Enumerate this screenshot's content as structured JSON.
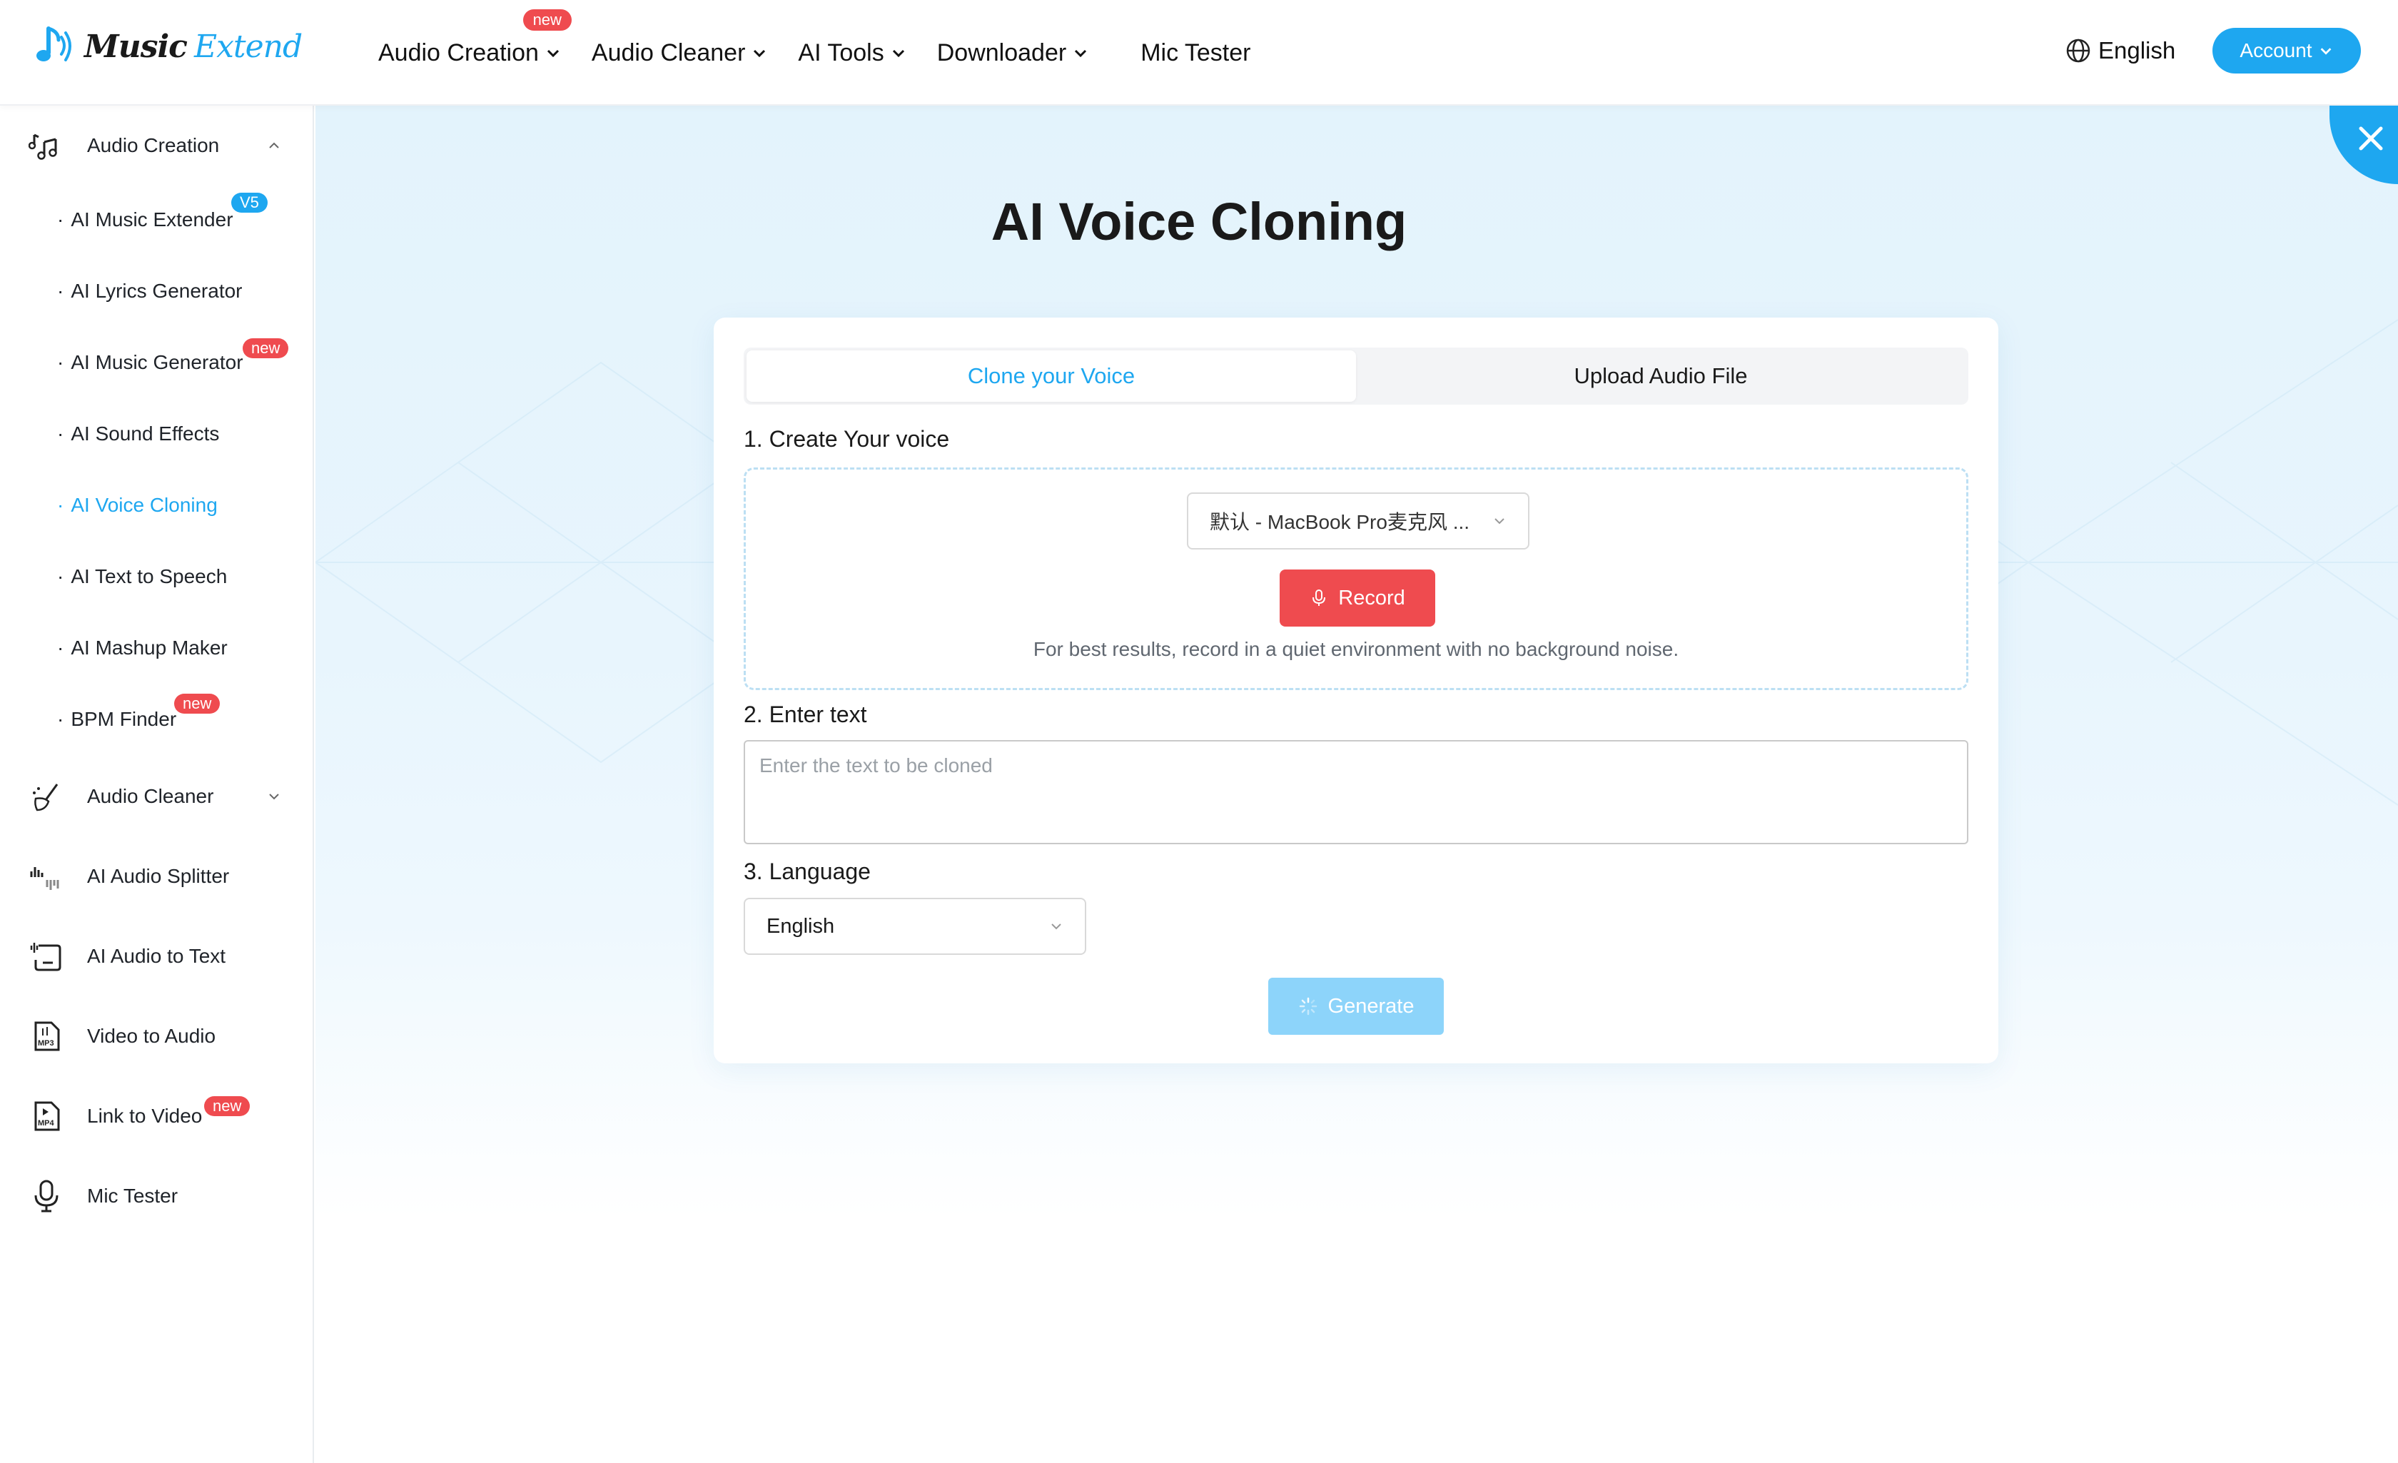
{
  "header": {
    "logo": {
      "word1": "Music",
      "word2": "Extend"
    },
    "nav": [
      {
        "label": "Audio Creation",
        "badge": "new",
        "dropdown": true
      },
      {
        "label": "Audio Cleaner",
        "dropdown": true
      },
      {
        "label": "AI Tools",
        "dropdown": true
      },
      {
        "label": "Downloader",
        "dropdown": true
      },
      {
        "label": "Mic Tester",
        "dropdown": false
      }
    ],
    "language": "English",
    "account_label": "Account"
  },
  "sidebar": {
    "groups": [
      {
        "label": "Audio Creation",
        "icon": "music-notes-icon",
        "expanded": true
      },
      {
        "label": "Audio Cleaner",
        "icon": "broom-icon",
        "expanded": false
      },
      {
        "label": "AI Audio Splitter",
        "icon": "waveform-icon"
      },
      {
        "label": "AI Audio to Text",
        "icon": "speech-to-text-icon"
      },
      {
        "label": "Video to Audio",
        "icon": "mp3-file-icon"
      },
      {
        "label": "Link to Video",
        "icon": "mp4-file-icon",
        "badge": "new"
      },
      {
        "label": "Mic Tester",
        "icon": "microphone-icon"
      }
    ],
    "sub_items": [
      {
        "label": "AI Music Extender",
        "badge": "V5"
      },
      {
        "label": "AI Lyrics Generator"
      },
      {
        "label": "AI Music Generator",
        "badge": "new"
      },
      {
        "label": "AI Sound Effects"
      },
      {
        "label": "AI Voice Cloning",
        "active": true
      },
      {
        "label": "AI Text to Speech"
      },
      {
        "label": "AI Mashup Maker"
      },
      {
        "label": "BPM Finder",
        "badge": "new"
      }
    ]
  },
  "main": {
    "title": "AI Voice Cloning",
    "tabs": [
      {
        "label": "Clone your Voice",
        "active": true
      },
      {
        "label": "Upload Audio File",
        "active": false
      }
    ],
    "step1": {
      "label": "1. Create Your voice",
      "mic_device": "默认 - MacBook Pro麦克风 ...",
      "record_label": "Record",
      "hint": "For best results, record in a quiet environment with no background noise."
    },
    "step2": {
      "label": "2. Enter text",
      "placeholder": "Enter the text to be cloned",
      "value": ""
    },
    "step3": {
      "label": "3. Language",
      "selected": "English"
    },
    "generate_label": "Generate"
  },
  "colors": {
    "accent": "#1ea7f0",
    "danger": "#ef4b4f",
    "generate_disabled": "#8dd4fa"
  }
}
